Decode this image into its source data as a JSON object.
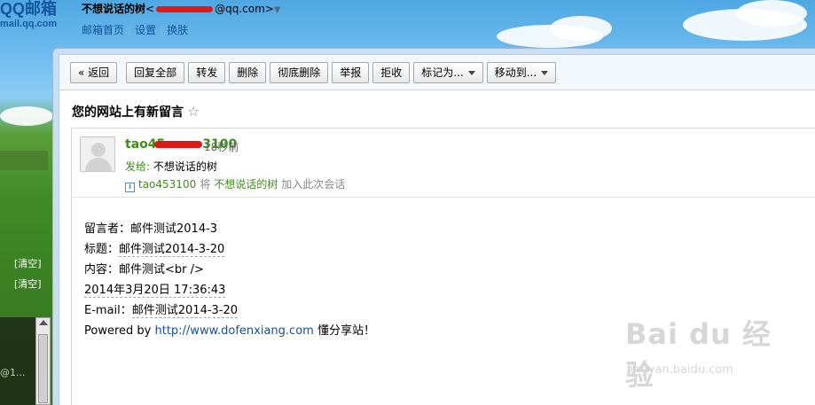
{
  "brand": {
    "logo_text": "QQ邮箱",
    "logo_sub": "mail.qq.com"
  },
  "account": {
    "nickname": "不想说话的树",
    "email_open": "<",
    "email_suffix": "@qq.com>",
    "dropdown_glyph": "▼",
    "links": [
      "邮箱首页",
      "设置",
      "换肤"
    ],
    "link_sep": "|"
  },
  "sidebar": {
    "clear_label_1": "[清空]",
    "clear_label_2": "[清空]",
    "dark_text": "@1..."
  },
  "toolbar": {
    "back": "« 返回",
    "reply_all": "回复全部",
    "forward": "转发",
    "delete": "删除",
    "delete_forever": "彻底删除",
    "report": "举报",
    "reject": "拒收",
    "mark_as": "标记为...",
    "move_to": "移动到..."
  },
  "message": {
    "subject": "您的网站上有新留言",
    "star_glyph": "☆",
    "sender_name": "tao45",
    "sender_name_end": "3100",
    "sent_time": "18秒前",
    "to_label": "发给:",
    "to_name": "不想说话的树",
    "info_icon": "i",
    "info_sender": "tao453100",
    "info_mid": "将",
    "info_name": "不想说话的树",
    "info_end": "加入此次会话",
    "body": {
      "line1": "留言者：邮件测试2014-3",
      "line2_label": "标题：",
      "line2_value": "邮件测试2014-3-20",
      "line3": "内容：邮件测试<br />",
      "line4": "2014年3月20日 17:36:43",
      "line5_label": "E-mail：",
      "line5_value": "邮件测试2014-3-20",
      "line6_prefix": "Powered by ",
      "line6_link": "http://www.dofenxiang.com",
      "line6_suffix": " 懂分享站！"
    }
  },
  "watermark": {
    "main": "Bai du 经验",
    "sub": "jingyan.baidu.com"
  }
}
